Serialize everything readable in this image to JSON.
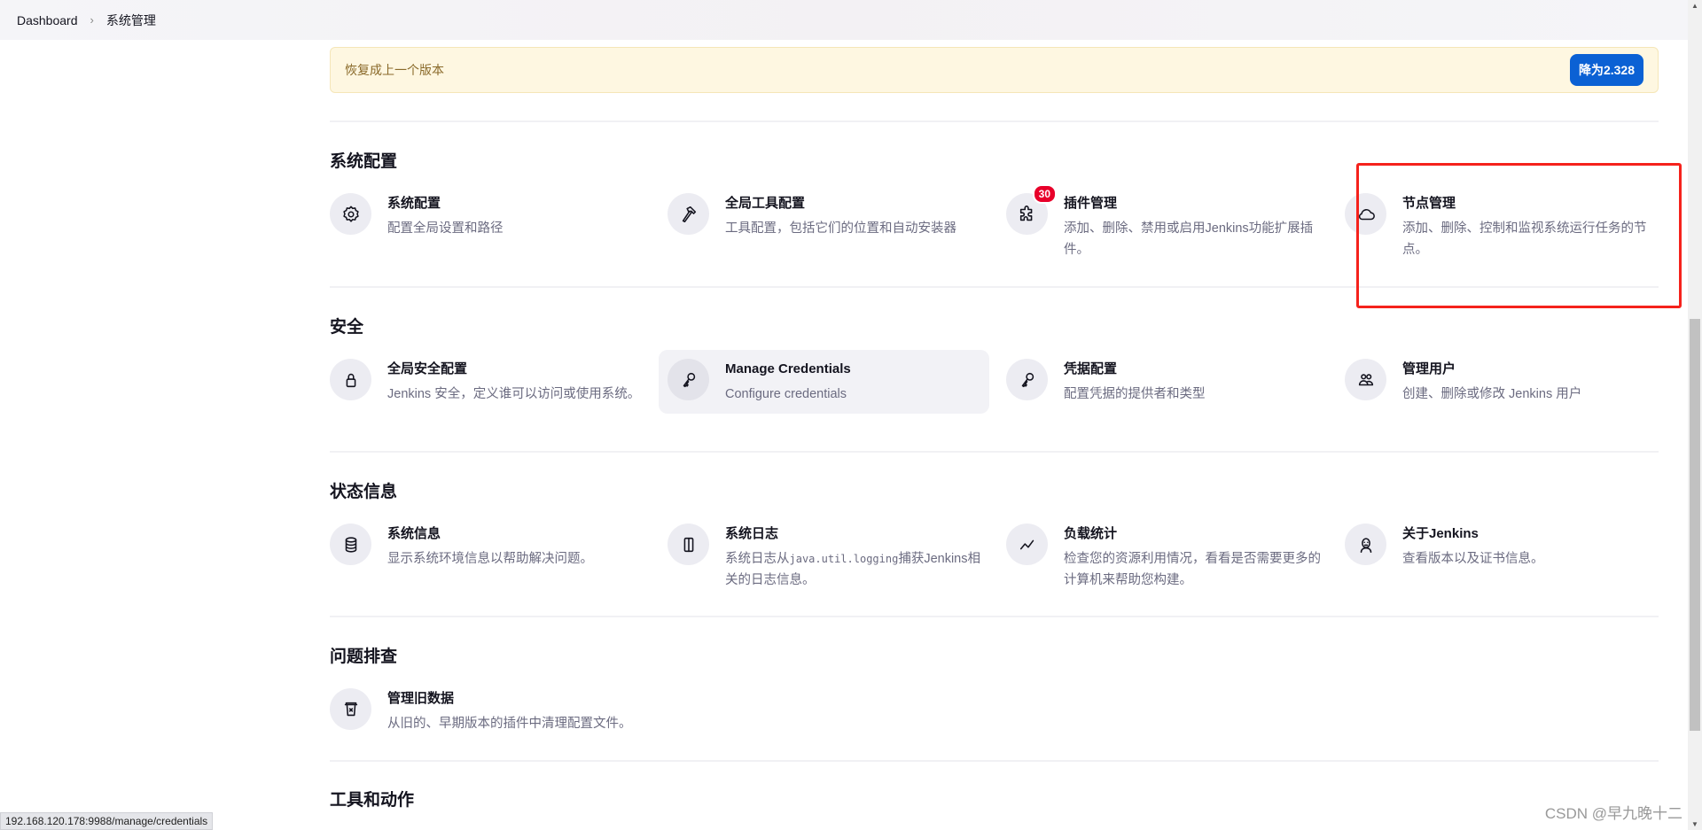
{
  "breadcrumb": {
    "home": "Dashboard",
    "current": "系统管理"
  },
  "banner": {
    "text": "恢复成上一个版本",
    "button": "降为2.328"
  },
  "sections": [
    {
      "title": "系统配置",
      "items": [
        {
          "title": "系统配置",
          "desc": "配置全局设置和路径",
          "icon": "gear-icon"
        },
        {
          "title": "全局工具配置",
          "desc": "工具配置，包括它们的位置和自动安装器",
          "icon": "hammer-icon"
        },
        {
          "title": "插件管理",
          "desc": "添加、删除、禁用或启用Jenkins功能扩展插件。",
          "icon": "puzzle-icon",
          "badge": "30"
        },
        {
          "title": "节点管理",
          "desc": "添加、删除、控制和监视系统运行任务的节点。",
          "icon": "cloud-icon"
        }
      ]
    },
    {
      "title": "安全",
      "items": [
        {
          "title": "全局安全配置",
          "desc": "Jenkins 安全，定义谁可以访问或使用系统。",
          "icon": "lock-icon"
        },
        {
          "title": "Manage Credentials",
          "desc": "Configure credentials",
          "icon": "key-icon"
        },
        {
          "title": "凭据配置",
          "desc": "配置凭据的提供者和类型",
          "icon": "key-icon"
        },
        {
          "title": "管理用户",
          "desc": "创建、删除或修改 Jenkins 用户",
          "icon": "users-icon"
        }
      ]
    },
    {
      "title": "状态信息",
      "items": [
        {
          "title": "系统信息",
          "desc": "显示系统环境信息以帮助解决问题。",
          "icon": "database-icon"
        },
        {
          "title": "系统日志",
          "desc_pre": "系统日志从",
          "desc_code": "java.util.logging",
          "desc_post": "捕获Jenkins相关的日志信息。",
          "icon": "log-icon"
        },
        {
          "title": "负载统计",
          "desc": "检查您的资源利用情况，看看是否需要更多的计算机来帮助您构建。",
          "icon": "chart-line-icon"
        },
        {
          "title": "关于Jenkins",
          "desc": "查看版本以及证书信息。",
          "icon": "jenkins-icon"
        }
      ]
    },
    {
      "title": "问题排查",
      "items": [
        {
          "title": "管理旧数据",
          "desc": "从旧的、早期版本的插件中清理配置文件。",
          "icon": "trash-icon"
        }
      ]
    },
    {
      "title": "工具和动作"
    }
  ],
  "status_url": "192.168.120.178:9988/manage/credentials",
  "watermark": "CSDN @早九晚十二"
}
